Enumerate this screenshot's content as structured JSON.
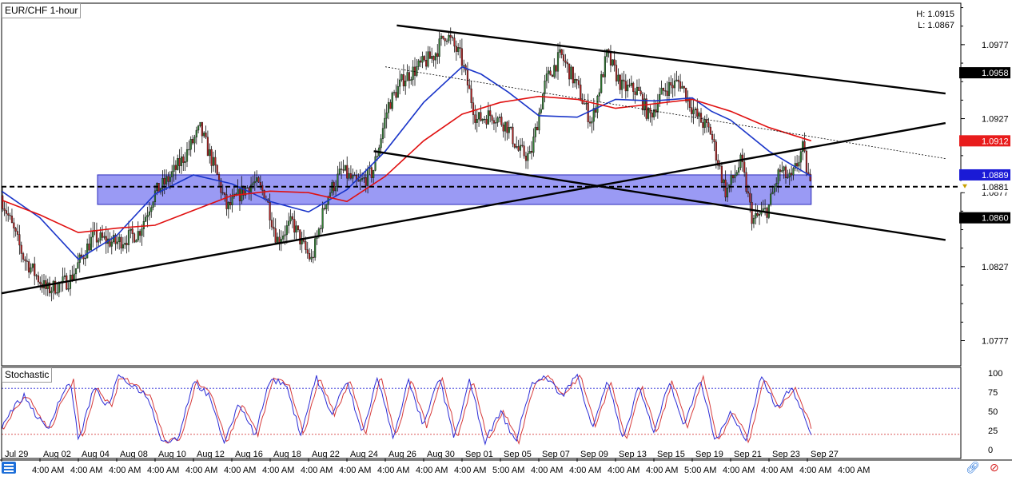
{
  "header": {
    "symbol": "EUR/CHF 1-hour",
    "high_label": "H: 1.0915",
    "low_label": "L: 1.0867"
  },
  "stochastic": {
    "label": "Stochastic"
  },
  "toolbar": {
    "menu_icon": "menu-icon",
    "link_icon": "link-icon",
    "close_icon": "close-icon"
  },
  "colors": {
    "bull_candle": "#2f7d32",
    "bear_candle": "#b22222",
    "ma_blue": "#1a35c9",
    "ma_red": "#e01010",
    "zone_fill": "#7878f0",
    "stoch_k": "#2b2bd6",
    "stoch_d": "#d63a3a",
    "level_black": "#000000",
    "level_red": "#e81c1c",
    "level_blue": "#1a1ad6",
    "level_current": "#ffffff"
  },
  "chart_data": [
    {
      "type": "candlestick",
      "title": "EUR/CHF 1-hour",
      "ylim": [
        1.076,
        1.1005
      ],
      "y_ticks": [
        "1.0977",
        "1.0927",
        "1.0877",
        "1.0827",
        "1.0777"
      ],
      "price_labels": [
        {
          "text": "1.0958",
          "value": 1.0958,
          "style": "black"
        },
        {
          "text": "1.0912",
          "value": 1.0912,
          "style": "red"
        },
        {
          "text": "1.0889",
          "value": 1.0889,
          "style": "blue"
        },
        {
          "text": "1.0881",
          "value": 1.0881,
          "style": "current"
        },
        {
          "text": "1.0860",
          "value": 1.086,
          "style": "black"
        }
      ],
      "x_labels_dates": [
        "Jul 29",
        "Aug 02",
        "Aug 04",
        "Aug 08",
        "Aug 10",
        "Aug 12",
        "Aug 16",
        "Aug 18",
        "Aug 22",
        "Aug 24",
        "Aug 26",
        "Aug 30",
        "Sep 01",
        "Sep 05",
        "Sep 07",
        "Sep 09",
        "Sep 13",
        "Sep 15",
        "Sep 19",
        "Sep 21",
        "Sep 23",
        "Sep 27"
      ],
      "x_labels_times": [
        "4:00 AM",
        "4:00 AM",
        "4:00 AM",
        "4:00 AM",
        "4:00 AM",
        "4:00 AM",
        "4:00 AM",
        "4:00 AM",
        "4:00 AM",
        "4:00 AM",
        "4:00 AM",
        "4:00 AM",
        "5:00 AM",
        "4:00 AM",
        "4:00 AM",
        "4:00 AM",
        "4:00 AM",
        "5:00 AM",
        "4:00 AM",
        "4:00 AM",
        "4:00 AM",
        "4:00 AM"
      ],
      "close_path": [
        [
          0,
          1.0875
        ],
        [
          0.6,
          1.0833
        ],
        [
          1.2,
          1.0811
        ],
        [
          1.8,
          1.0818
        ],
        [
          2.4,
          1.0847
        ],
        [
          3.0,
          1.0843
        ],
        [
          3.6,
          1.085
        ],
        [
          4.0,
          1.0876
        ],
        [
          4.4,
          1.0887
        ],
        [
          4.8,
          1.0902
        ],
        [
          5.2,
          1.092
        ],
        [
          5.6,
          1.0892
        ],
        [
          5.9,
          1.0866
        ],
        [
          6.3,
          1.0878
        ],
        [
          6.6,
          1.0884
        ],
        [
          6.9,
          1.0876
        ],
        [
          7.2,
          1.0845
        ],
        [
          7.6,
          1.0857
        ],
        [
          7.9,
          1.084
        ],
        [
          8.1,
          1.0831
        ],
        [
          8.5,
          1.0874
        ],
        [
          8.9,
          1.0892
        ],
        [
          9.3,
          1.0882
        ],
        [
          9.7,
          1.0891
        ],
        [
          10.1,
          1.0936
        ],
        [
          10.5,
          1.0954
        ],
        [
          10.9,
          1.0962
        ],
        [
          11.3,
          1.097
        ],
        [
          11.6,
          1.0985
        ],
        [
          12.0,
          1.0968
        ],
        [
          12.4,
          1.0926
        ],
        [
          12.8,
          1.093
        ],
        [
          13.2,
          1.0922
        ],
        [
          13.5,
          1.0905
        ],
        [
          13.8,
          1.0901
        ],
        [
          14.2,
          1.0952
        ],
        [
          14.6,
          1.097
        ],
        [
          15.0,
          1.095
        ],
        [
          15.4,
          1.0924
        ],
        [
          15.8,
          1.097
        ],
        [
          16.2,
          1.0948
        ],
        [
          16.6,
          1.0946
        ],
        [
          16.9,
          1.0928
        ],
        [
          17.3,
          1.0947
        ],
        [
          17.7,
          1.0952
        ],
        [
          18.1,
          1.093
        ],
        [
          18.5,
          1.0918
        ],
        [
          18.9,
          1.0877
        ],
        [
          19.3,
          1.0898
        ],
        [
          19.6,
          1.0858
        ],
        [
          20.0,
          1.0866
        ],
        [
          20.3,
          1.0892
        ],
        [
          20.6,
          1.0885
        ],
        [
          20.9,
          1.0907
        ],
        [
          21.1,
          1.0881
        ]
      ],
      "moving_averages": [
        {
          "color": "blue",
          "points": [
            [
              0,
              1.0878
            ],
            [
              1.0,
              1.086
            ],
            [
              2.0,
              1.0832
            ],
            [
              3.0,
              1.0848
            ],
            [
              4.0,
              1.0876
            ],
            [
              5.0,
              1.0889
            ],
            [
              6.0,
              1.0883
            ],
            [
              7.0,
              1.0871
            ],
            [
              8.0,
              1.0864
            ],
            [
              9.0,
              1.0879
            ],
            [
              10.0,
              1.0905
            ],
            [
              11.0,
              1.0938
            ],
            [
              12.0,
              1.0962
            ],
            [
              12.5,
              1.0957
            ],
            [
              13.2,
              1.0945
            ],
            [
              14.0,
              1.0929
            ],
            [
              15.0,
              1.0928
            ],
            [
              16.0,
              1.094
            ],
            [
              17.0,
              1.0939
            ],
            [
              18.0,
              1.0941
            ],
            [
              18.5,
              1.0932
            ],
            [
              19.0,
              1.0926
            ],
            [
              20.0,
              1.0905
            ],
            [
              21.1,
              1.0888
            ]
          ]
        },
        {
          "color": "red",
          "points": [
            [
              0,
              1.0872
            ],
            [
              1.0,
              1.0862
            ],
            [
              2.0,
              1.085
            ],
            [
              3.0,
              1.0853
            ],
            [
              4.0,
              1.0855
            ],
            [
              5.0,
              1.0865
            ],
            [
              6.0,
              1.0875
            ],
            [
              7.0,
              1.0878
            ],
            [
              8.0,
              1.0877
            ],
            [
              9.0,
              1.0871
            ],
            [
              10.0,
              1.0888
            ],
            [
              11.0,
              1.0912
            ],
            [
              12.0,
              1.093
            ],
            [
              13.0,
              1.0938
            ],
            [
              14.0,
              1.0942
            ],
            [
              15.0,
              1.094
            ],
            [
              16.0,
              1.0934
            ],
            [
              17.0,
              1.0937
            ],
            [
              18.0,
              1.094
            ],
            [
              19.0,
              1.0932
            ],
            [
              20.0,
              1.0921
            ],
            [
              21.1,
              1.0912
            ]
          ]
        }
      ],
      "trendlines": [
        {
          "style": "solid",
          "points": [
            [
              10.3,
              1.099
            ],
            [
              24.6,
              1.0944
            ]
          ]
        },
        {
          "style": "solid",
          "points": [
            [
              0,
              1.0809
            ],
            [
              24.6,
              1.0924
            ]
          ]
        },
        {
          "style": "solid",
          "points": [
            [
              9.7,
              1.0905
            ],
            [
              24.6,
              1.0845
            ]
          ]
        },
        {
          "style": "dotted",
          "points": [
            [
              10.0,
              1.0962
            ],
            [
              24.6,
              1.09
            ]
          ]
        },
        {
          "style": "dashed",
          "points": [
            [
              0,
              1.0881
            ],
            [
              24.6,
              1.0881
            ]
          ]
        }
      ],
      "zone": {
        "x": [
          2.5,
          21.1
        ],
        "y": [
          1.0869,
          1.0889
        ]
      },
      "series": [
        {
          "name": "EUR/CHF 1-hour",
          "values_source": "close_path"
        }
      ]
    },
    {
      "type": "line",
      "title": "Stochastic",
      "ylim": [
        0,
        100
      ],
      "y_ticks": [
        100,
        75,
        50,
        25,
        0
      ],
      "levels": [
        80,
        20
      ],
      "k_path": [
        [
          0,
          30
        ],
        [
          0.3,
          55
        ],
        [
          0.6,
          70
        ],
        [
          0.9,
          45
        ],
        [
          1.2,
          25
        ],
        [
          1.5,
          65
        ],
        [
          1.8,
          90
        ],
        [
          2.0,
          10
        ],
        [
          2.4,
          80
        ],
        [
          2.8,
          55
        ],
        [
          3.0,
          95
        ],
        [
          3.4,
          85
        ],
        [
          3.8,
          70
        ],
        [
          4.2,
          10
        ],
        [
          4.6,
          15
        ],
        [
          5.0,
          90
        ],
        [
          5.4,
          70
        ],
        [
          5.8,
          10
        ],
        [
          6.2,
          60
        ],
        [
          6.6,
          20
        ],
        [
          7.0,
          92
        ],
        [
          7.4,
          85
        ],
        [
          7.8,
          20
        ],
        [
          8.2,
          95
        ],
        [
          8.6,
          45
        ],
        [
          9.0,
          90
        ],
        [
          9.4,
          20
        ],
        [
          9.8,
          95
        ],
        [
          10.2,
          15
        ],
        [
          10.6,
          90
        ],
        [
          11.0,
          30
        ],
        [
          11.4,
          95
        ],
        [
          11.8,
          15
        ],
        [
          12.2,
          90
        ],
        [
          12.6,
          10
        ],
        [
          13.0,
          50
        ],
        [
          13.4,
          10
        ],
        [
          13.8,
          85
        ],
        [
          14.2,
          95
        ],
        [
          14.6,
          70
        ],
        [
          15.0,
          98
        ],
        [
          15.4,
          30
        ],
        [
          15.8,
          90
        ],
        [
          16.2,
          10
        ],
        [
          16.6,
          85
        ],
        [
          17.0,
          20
        ],
        [
          17.4,
          90
        ],
        [
          17.8,
          30
        ],
        [
          18.2,
          95
        ],
        [
          18.6,
          10
        ],
        [
          19.0,
          50
        ],
        [
          19.4,
          10
        ],
        [
          19.8,
          95
        ],
        [
          20.2,
          55
        ],
        [
          20.6,
          82
        ],
        [
          21.1,
          20
        ]
      ]
    }
  ]
}
